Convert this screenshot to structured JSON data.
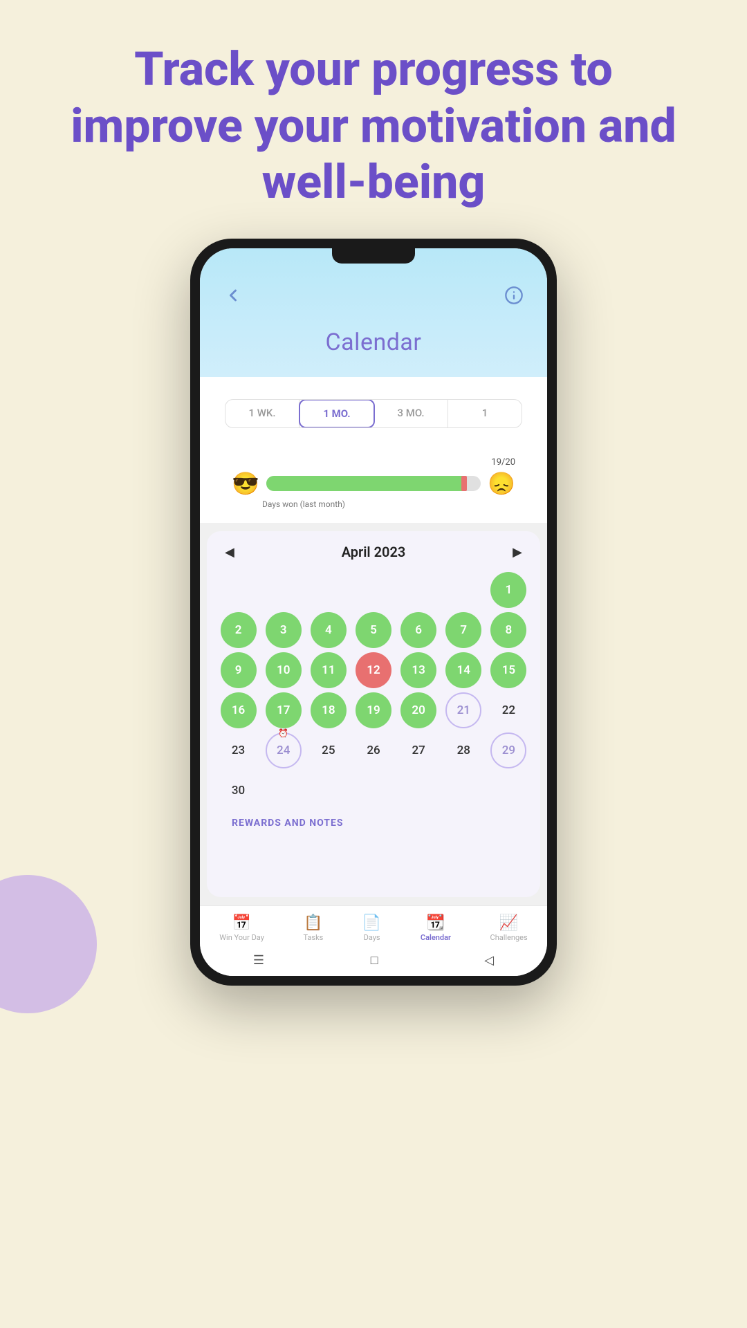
{
  "headline": "Track your progress\nto improve your\nmotivation and well-being",
  "phone": {
    "header": {
      "title": "Calendar",
      "back_label": "←",
      "info_label": "ℹ"
    },
    "period_tabs": [
      {
        "label": "1 WK.",
        "id": "1wk",
        "active": false
      },
      {
        "label": "1 MO.",
        "id": "1mo",
        "active": true
      },
      {
        "label": "3 MO.",
        "id": "3mo",
        "active": false
      },
      {
        "label": "1",
        "id": "1",
        "active": false
      }
    ],
    "progress": {
      "score": "19/20",
      "label": "Days won (last month)",
      "fill_percent": 93,
      "emoji_good": "😎",
      "emoji_bad": "😞"
    },
    "calendar": {
      "month": "April 2023",
      "days": [
        {
          "num": "",
          "state": "empty"
        },
        {
          "num": "",
          "state": "empty"
        },
        {
          "num": "",
          "state": "empty"
        },
        {
          "num": "",
          "state": "empty"
        },
        {
          "num": "",
          "state": "empty"
        },
        {
          "num": "",
          "state": "empty"
        },
        {
          "num": "1",
          "state": "green"
        },
        {
          "num": "2",
          "state": "green"
        },
        {
          "num": "3",
          "state": "green"
        },
        {
          "num": "4",
          "state": "green"
        },
        {
          "num": "5",
          "state": "green"
        },
        {
          "num": "6",
          "state": "green"
        },
        {
          "num": "7",
          "state": "green"
        },
        {
          "num": "8",
          "state": "green"
        },
        {
          "num": "9",
          "state": "green"
        },
        {
          "num": "10",
          "state": "green"
        },
        {
          "num": "11",
          "state": "green"
        },
        {
          "num": "12",
          "state": "red"
        },
        {
          "num": "13",
          "state": "green"
        },
        {
          "num": "14",
          "state": "green"
        },
        {
          "num": "15",
          "state": "green"
        },
        {
          "num": "16",
          "state": "green"
        },
        {
          "num": "17",
          "state": "green"
        },
        {
          "num": "18",
          "state": "green"
        },
        {
          "num": "19",
          "state": "green"
        },
        {
          "num": "20",
          "state": "green"
        },
        {
          "num": "21",
          "state": "purple-outline"
        },
        {
          "num": "22",
          "state": "empty"
        },
        {
          "num": "23",
          "state": "empty"
        },
        {
          "num": "24",
          "state": "alarm"
        },
        {
          "num": "25",
          "state": "empty"
        },
        {
          "num": "26",
          "state": "empty"
        },
        {
          "num": "27",
          "state": "empty"
        },
        {
          "num": "28",
          "state": "empty"
        },
        {
          "num": "29",
          "state": "purple-outline"
        },
        {
          "num": "30",
          "state": "empty"
        }
      ]
    },
    "rewards_label": "REWARDS AND NOTES",
    "nav_items": [
      {
        "label": "Win Your Day",
        "icon": "📅",
        "active": false,
        "id": "win"
      },
      {
        "label": "Tasks",
        "icon": "📋",
        "active": false,
        "id": "tasks"
      },
      {
        "label": "Days",
        "icon": "📄",
        "active": false,
        "id": "days"
      },
      {
        "label": "Calendar",
        "icon": "📆",
        "active": true,
        "id": "calendar"
      },
      {
        "label": "Challenges",
        "icon": "📈",
        "active": false,
        "id": "challenges"
      }
    ]
  }
}
